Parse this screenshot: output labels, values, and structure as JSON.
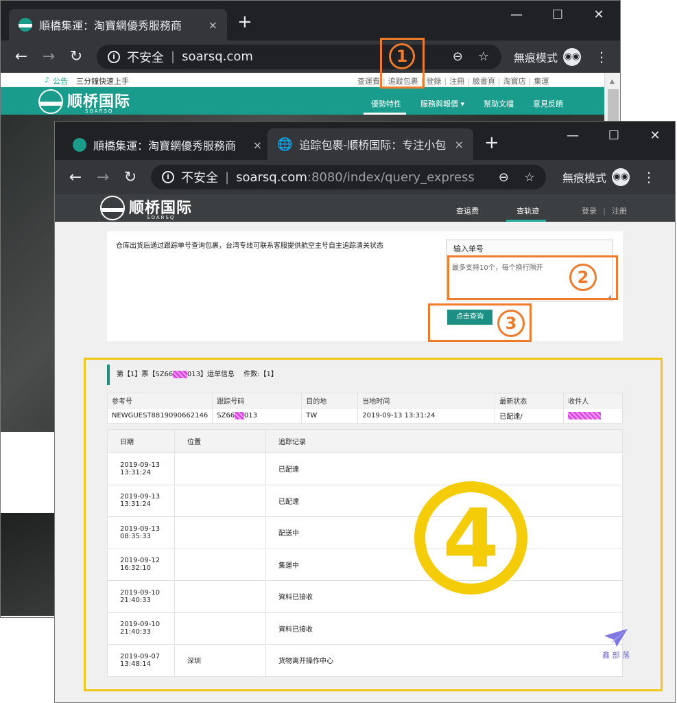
{
  "back_window": {
    "tab_title": "順橋集運：淘寶網優秀服務商",
    "tab_close": "×",
    "new_tab": "+",
    "window_controls": [
      "—",
      "☐",
      "✕"
    ],
    "address": {
      "insecure": "不安全",
      "host": "soarsq.com",
      "path": ""
    },
    "incognito_label": "無痕模式",
    "notice_icon": "bell-icon",
    "notice_label": "公告",
    "notice_text": "三分鐘快速上手",
    "top_links": [
      "查運費",
      "追蹤包裹",
      "登錄",
      "注冊",
      "臉書頁",
      "淘寶店",
      "集運"
    ],
    "logo_name": "顺桥国际",
    "logo_sub": "SOARSQ",
    "main_nav": [
      "優勢特性",
      "服務與報價 ▾",
      "幫助文檔",
      "意見反饋"
    ],
    "callout_1": "1"
  },
  "front_window": {
    "tabs": [
      {
        "title": "順橋集運：淘寶網優秀服務商"
      },
      {
        "title": "追踪包裹-顺桥国际：专注小包"
      }
    ],
    "tab_close": "×",
    "new_tab": "+",
    "window_controls": [
      "—",
      "☐",
      "✕"
    ],
    "address": {
      "insecure": "不安全",
      "host": "soarsq.com",
      "path": ":8080/index/query_express"
    },
    "incognito_label": "無痕模式",
    "site": {
      "logo_name": "顺桥国际",
      "logo_sub": "SOARSQ",
      "nav": [
        "查运费",
        "查轨迹"
      ],
      "login": "登录",
      "sep": "|",
      "register": "注册"
    },
    "query": {
      "description": "仓库出货后通过跟踪单号查询包裹，台湾专线可联系客服提供航空主号自主追踪清关状态",
      "input_label": "输入单号",
      "placeholder": "最多支持10个，每个换行隔开",
      "button": "点击查询"
    },
    "callout_2": "2",
    "callout_3": "3",
    "result": {
      "heading_prefix": "第【1】票【SZ66",
      "heading_suffix": "013】运单信息",
      "count": "件数:【1】",
      "summary_headers": [
        "参考号",
        "跟踪号码",
        "目的地",
        "当地时间",
        "最新状态",
        "收件人"
      ],
      "summary_row": {
        "ref": "NEWGUEST8819090662146",
        "tracking_prefix": "SZ66",
        "tracking_suffix": "013",
        "dest": "TW",
        "time": "2019-09-13 13:31:24",
        "status": "已配達/"
      },
      "track_headers": [
        "日期",
        "位置",
        "追踪记录"
      ],
      "track_rows": [
        {
          "date": "2019-09-13",
          "time": "13:31:24",
          "location": "",
          "record": "已配達"
        },
        {
          "date": "2019-09-13",
          "time": "13:31:24",
          "location": "",
          "record": "已配達"
        },
        {
          "date": "2019-09-13",
          "time": "08:35:33",
          "location": "",
          "record": "配送中"
        },
        {
          "date": "2019-09-12",
          "time": "16:32:10",
          "location": "",
          "record": "集運中"
        },
        {
          "date": "2019-09-10",
          "time": "21:40:33",
          "location": "",
          "record": "資料已接收"
        },
        {
          "date": "2019-09-10",
          "time": "21:40:33",
          "location": "",
          "record": "資料已接收"
        },
        {
          "date": "2019-09-07",
          "time": "13:48:14",
          "location": "深圳",
          "record": "货物离开操作中心"
        }
      ]
    },
    "callout_4": "4",
    "watermark": "鑫 部 落"
  }
}
